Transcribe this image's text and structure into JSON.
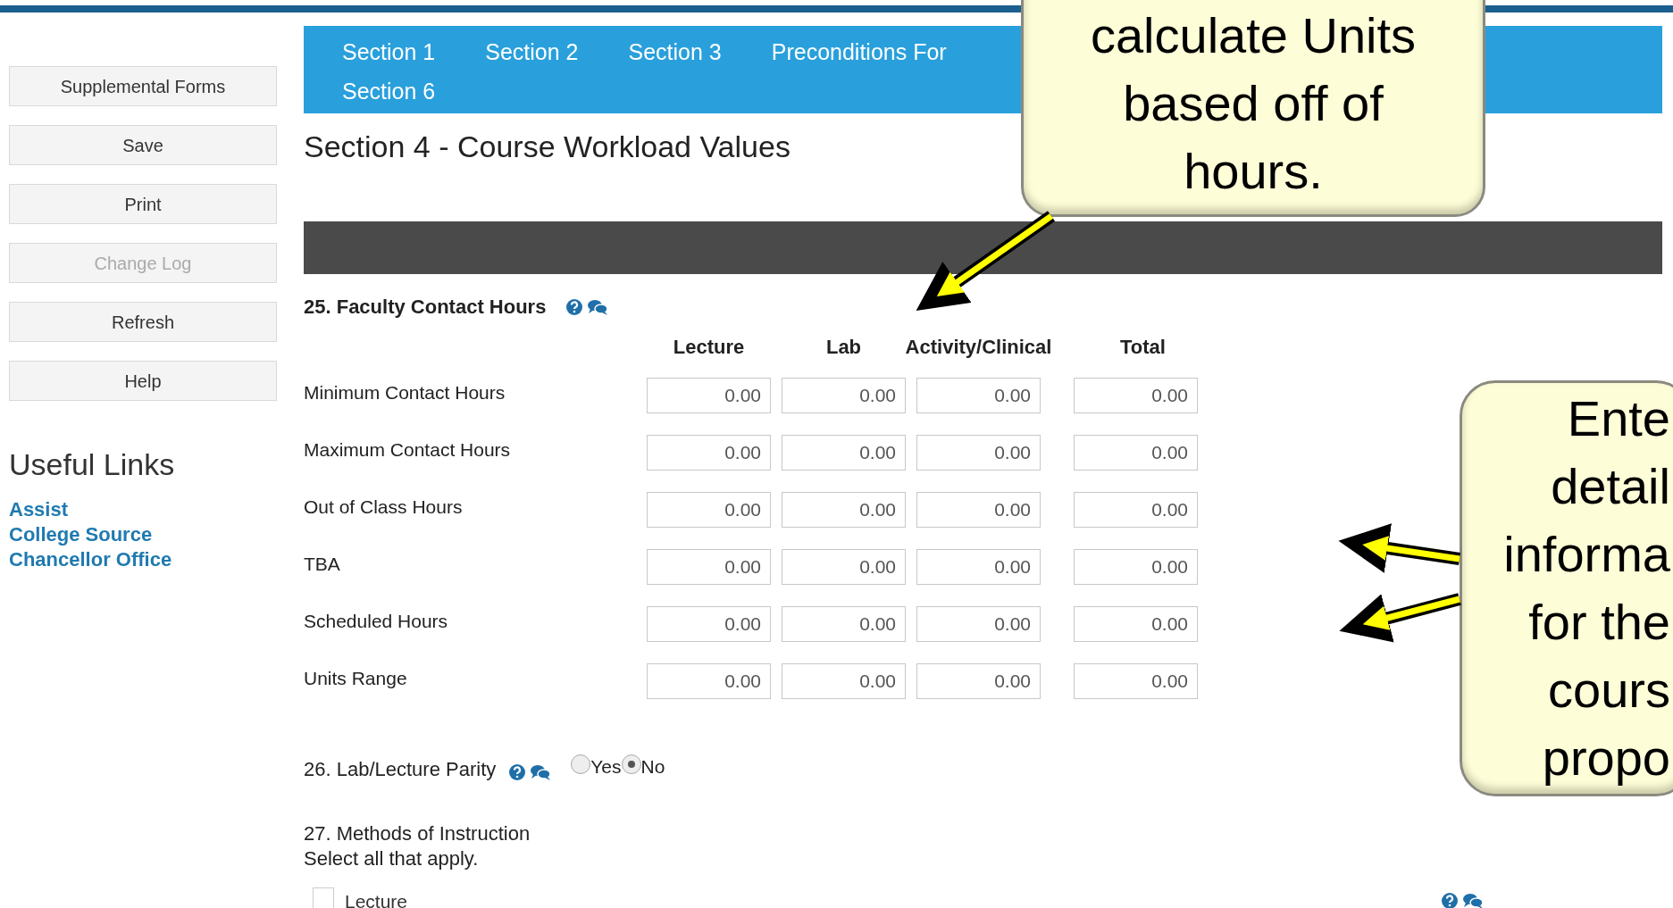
{
  "sidebar": {
    "buttons": [
      {
        "label": "Supplemental Forms",
        "disabled": false
      },
      {
        "label": "Save",
        "disabled": false
      },
      {
        "label": "Print",
        "disabled": false
      },
      {
        "label": "Change Log",
        "disabled": true
      },
      {
        "label": "Refresh",
        "disabled": false
      },
      {
        "label": "Help",
        "disabled": false
      }
    ],
    "useful_links": {
      "title": "Useful Links",
      "links": [
        "Assist",
        "College Source",
        "Chancellor Office"
      ]
    }
  },
  "nav": {
    "tab_rows": [
      [
        "Section 1",
        "Section 2",
        "Section 3",
        "Preconditions For"
      ],
      [
        "Section 6"
      ]
    ]
  },
  "heading": "Section 4 - Course Workload Values",
  "q25": {
    "title": "25. Faculty Contact Hours",
    "columns": [
      "Lecture",
      "Lab",
      "Activity/Clinical",
      "Total"
    ],
    "rows": [
      {
        "label": "Minimum Contact Hours",
        "values": [
          "0.00",
          "0.00",
          "0.00",
          "0.00"
        ]
      },
      {
        "label": "Maximum Contact Hours",
        "values": [
          "0.00",
          "0.00",
          "0.00",
          "0.00"
        ]
      },
      {
        "label": "Out of Class Hours",
        "values": [
          "0.00",
          "0.00",
          "0.00",
          "0.00"
        ]
      },
      {
        "label": "TBA",
        "values": [
          "0.00",
          "0.00",
          "0.00",
          "0.00"
        ]
      },
      {
        "label": "Scheduled Hours",
        "values": [
          "0.00",
          "0.00",
          "0.00",
          "0.00"
        ]
      },
      {
        "label": "Units Range",
        "values": [
          "0.00",
          "0.00",
          "0.00",
          "0.00"
        ]
      }
    ]
  },
  "q26": {
    "title": "26. Lab/Lecture Parity",
    "options": [
      {
        "label": "Yes",
        "selected": false
      },
      {
        "label": "No",
        "selected": true
      }
    ]
  },
  "q27": {
    "title": "27. Methods of Instruction",
    "hint": "Select all that apply.",
    "options": [
      {
        "label": "Lecture",
        "checked": false
      }
    ]
  },
  "callouts": [
    {
      "lines": [
        "calculate Units",
        "based off of",
        "hours."
      ]
    },
    {
      "lines": [
        "Ente",
        "detail",
        "informa",
        "for the",
        "cours",
        "propo"
      ]
    }
  ]
}
